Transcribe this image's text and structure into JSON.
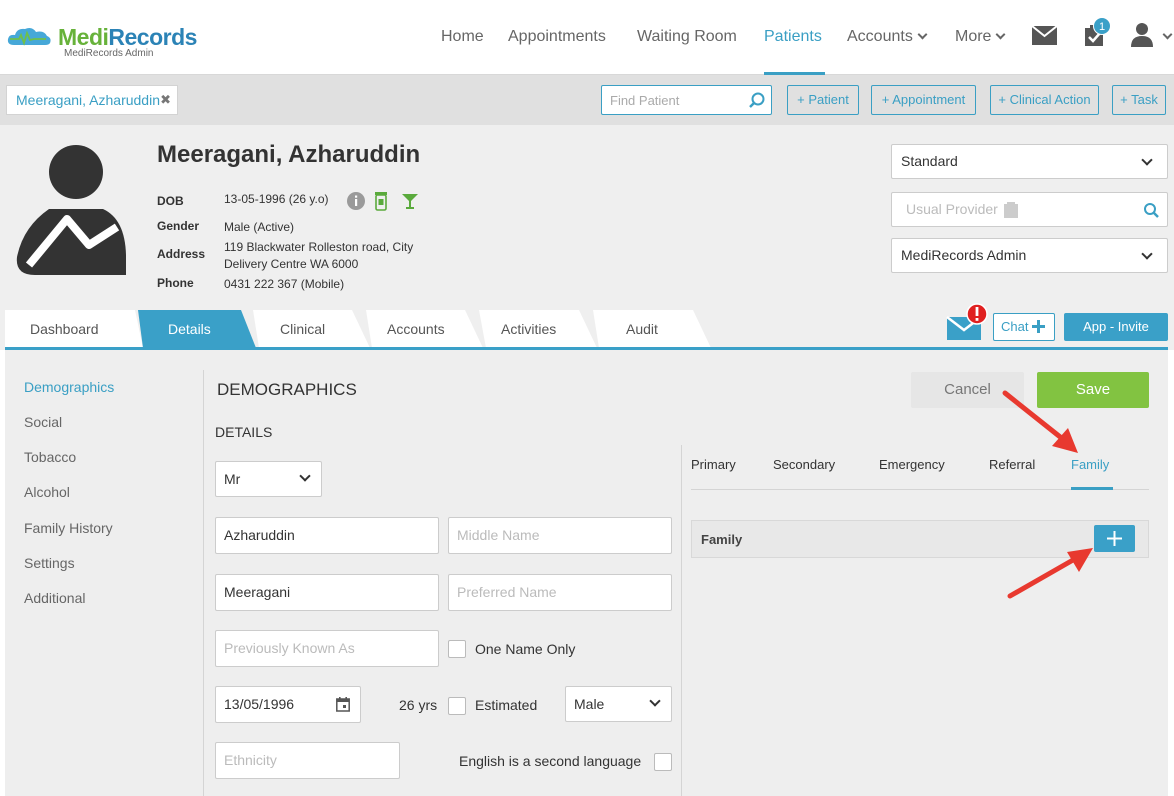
{
  "brand": {
    "name_part1": "Medi",
    "name_part2": "Records",
    "sub": "MediRecords Admin"
  },
  "nav": {
    "items": [
      {
        "label": "Home"
      },
      {
        "label": "Appointments"
      },
      {
        "label": "Waiting Room"
      },
      {
        "label": "Patients"
      },
      {
        "label": "Accounts"
      },
      {
        "label": "More"
      }
    ],
    "task_badge": "1"
  },
  "subbar": {
    "patient_tab": "Meeragani, Azharuddin",
    "patient_tab_close": "✖",
    "find_placeholder": "Find Patient",
    "buttons": [
      "+ Patient",
      "+ Appointment",
      "+ Clinical Action",
      "+ Task"
    ]
  },
  "patient": {
    "name": "Meeragani, Azharuddin",
    "dob_label": "DOB",
    "dob": "13-05-1996 (26 y.o)",
    "gender_label": "Gender",
    "gender": "Male (Active)",
    "address_label": "Address",
    "address_line1": "119 Blackwater Rolleston road, City",
    "address_line2": "Delivery Centre WA 6000",
    "phone_label": "Phone",
    "phone": "0431 222 367 (Mobile)"
  },
  "right_selects": {
    "standard": "Standard",
    "usual_provider_placeholder": "Usual Provider",
    "admin": "MediRecords Admin"
  },
  "tabs": [
    "Dashboard",
    "Details",
    "Clinical",
    "Accounts",
    "Activities",
    "Audit"
  ],
  "actions": {
    "chat": "Chat",
    "app_invite": "App - Invite"
  },
  "sidebar": [
    "Demographics",
    "Social",
    "Tobacco",
    "Alcohol",
    "Family History",
    "Settings",
    "Additional"
  ],
  "form": {
    "heading": "DEMOGRAPHICS",
    "subheading": "DETAILS",
    "cancel": "Cancel",
    "save": "Save",
    "title_value": "Mr",
    "first_name": "Azharuddin",
    "middle_placeholder": "Middle Name",
    "last_name": "Meeragani",
    "preferred_placeholder": "Preferred Name",
    "prev_known_placeholder": "Previously Known As",
    "one_name_only": "One Name Only",
    "dob_value": "13/05/1996",
    "age": "26 yrs",
    "estimated": "Estimated",
    "sex_value": "Male",
    "ethnicity_placeholder": "Ethnicity",
    "english_second": "English is a second language"
  },
  "contacts": {
    "tabs": [
      "Primary",
      "Secondary",
      "Emergency",
      "Referral",
      "Family"
    ],
    "family_label": "Family"
  },
  "colors": {
    "accent": "#3aa0c8",
    "save": "#82c341",
    "alert": "#e02020",
    "arrow": "#e8392f"
  }
}
